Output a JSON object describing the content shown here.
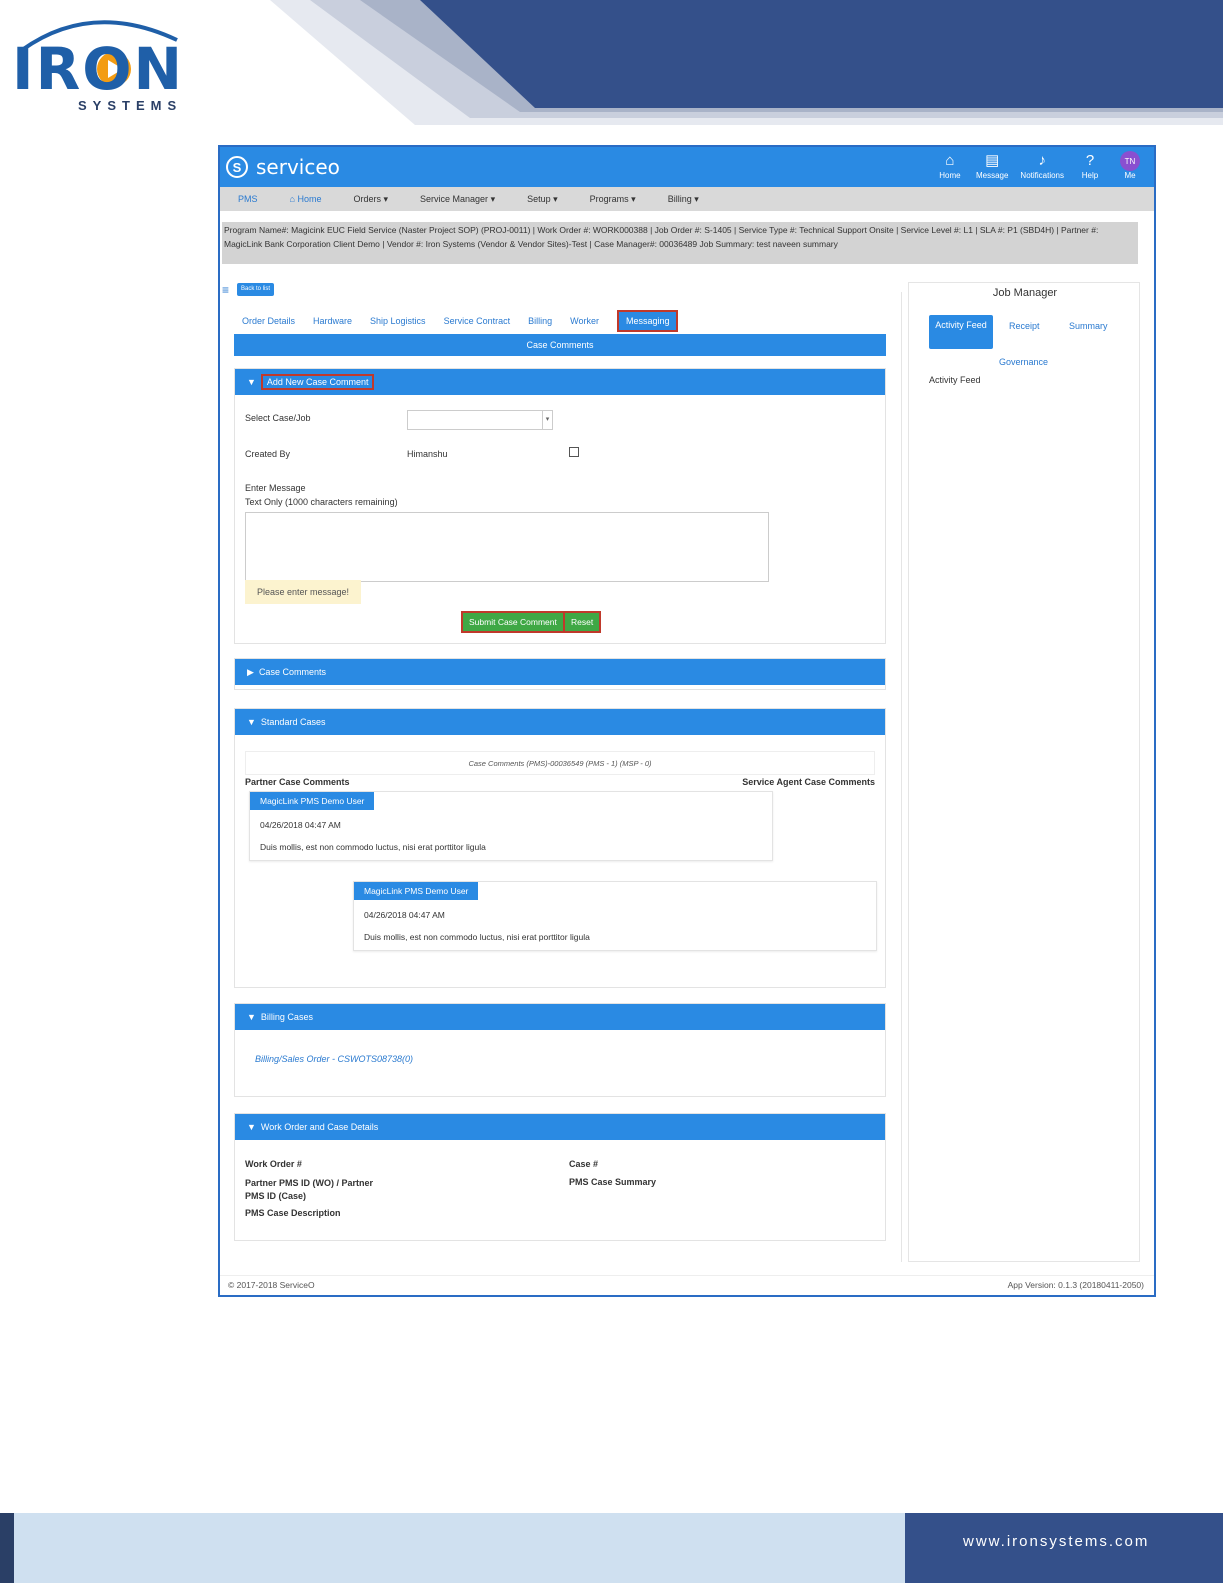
{
  "company": {
    "logo_text": "IRON",
    "logo_sub": "SYSTEMS",
    "website": "www.ironsystems.com",
    "colors": {
      "navy": "#34508a",
      "brand_blue": "#2a8ae3",
      "highlight_red": "#c0392b",
      "submit_green": "#3fa845"
    }
  },
  "app": {
    "brand": "serviceo",
    "top_icons": [
      {
        "icon": "home-icon",
        "label": "Home"
      },
      {
        "icon": "message-icon",
        "label": "Message"
      },
      {
        "icon": "bell-icon",
        "label": "Notifications"
      },
      {
        "icon": "help-icon",
        "label": "Help"
      },
      {
        "icon": "avatar",
        "initials": "TN",
        "label": "Me"
      }
    ],
    "nav": [
      "PMS",
      "Home",
      "Orders",
      "Service Manager",
      "Setup",
      "Programs",
      "Billing"
    ],
    "info": "Program Name#: Magicink EUC Field Service (Naster Project SOP) (PROJ-0011)  |  Work Order #: WORK000388  |  Job Order #: S-1405  |  Service Type #: Technical Support Onsite  |  Service Level #: L1  |  SLA #: P1 (SBD4H)  |  Partner #: MagicLink Bank Corporation Client Demo  |  Vendor #: Iron Systems (Vendor & Vendor Sites)-Test  |  Case Manager#: 00036489 Job Summary: test naveen summary",
    "back_label": "Back to list",
    "tabs": [
      "Order Details",
      "Hardware",
      "Ship Logistics",
      "Service Contract",
      "Billing",
      "Worker",
      "Messaging"
    ],
    "case_comments_bar": "Case Comments",
    "add_comment": {
      "title": "Add New Case Comment",
      "select_label": "Select Case/Job",
      "created_by_label": "Created By",
      "created_by_value": "Himanshu",
      "enter_message_label": "Enter Message",
      "text_hint": "Text Only (1000 characters remaining)",
      "warning": "Please enter message!",
      "submit": "Submit Case Comment",
      "reset": "Reset"
    },
    "case_comments_panel": "Case Comments",
    "standard_cases": {
      "title": "Standard Cases",
      "header": "Case Comments (PMS)-00036549 (PMS - 1) (MSP - 0)",
      "partner_label": "Partner Case Comments",
      "agent_label": "Service Agent Case Comments",
      "comments": [
        {
          "user": "MagicLink PMS Demo User",
          "date": "04/26/2018 04:47 AM",
          "text": "Duis mollis, est non commodo luctus, nisi erat porttitor ligula"
        },
        {
          "user": "MagicLink PMS Demo User",
          "date": "04/26/2018 04:47 AM",
          "text": "Duis mollis, est non commodo luctus, nisi erat porttitor ligula"
        }
      ]
    },
    "billing_cases": {
      "title": "Billing Cases",
      "link": "Billing/Sales Order - CSWOTS08738(0)"
    },
    "wo_details": {
      "title": "Work Order and Case Details",
      "work_order": "Work Order #",
      "case": "Case #",
      "partner_pms": "Partner PMS ID (WO) / Partner PMS ID (Case)",
      "pms_summary": "PMS Case Summary",
      "pms_description": "PMS Case Description"
    },
    "job_manager": {
      "title": "Job Manager",
      "tabs": [
        "Activity Feed",
        "Receipt",
        "Summary",
        "Governance"
      ],
      "feed_label": "Activity Feed"
    },
    "footer": {
      "copyright": "© 2017-2018 ServiceO",
      "version": "App Version: 0.1.3 (20180411-2050)"
    }
  }
}
